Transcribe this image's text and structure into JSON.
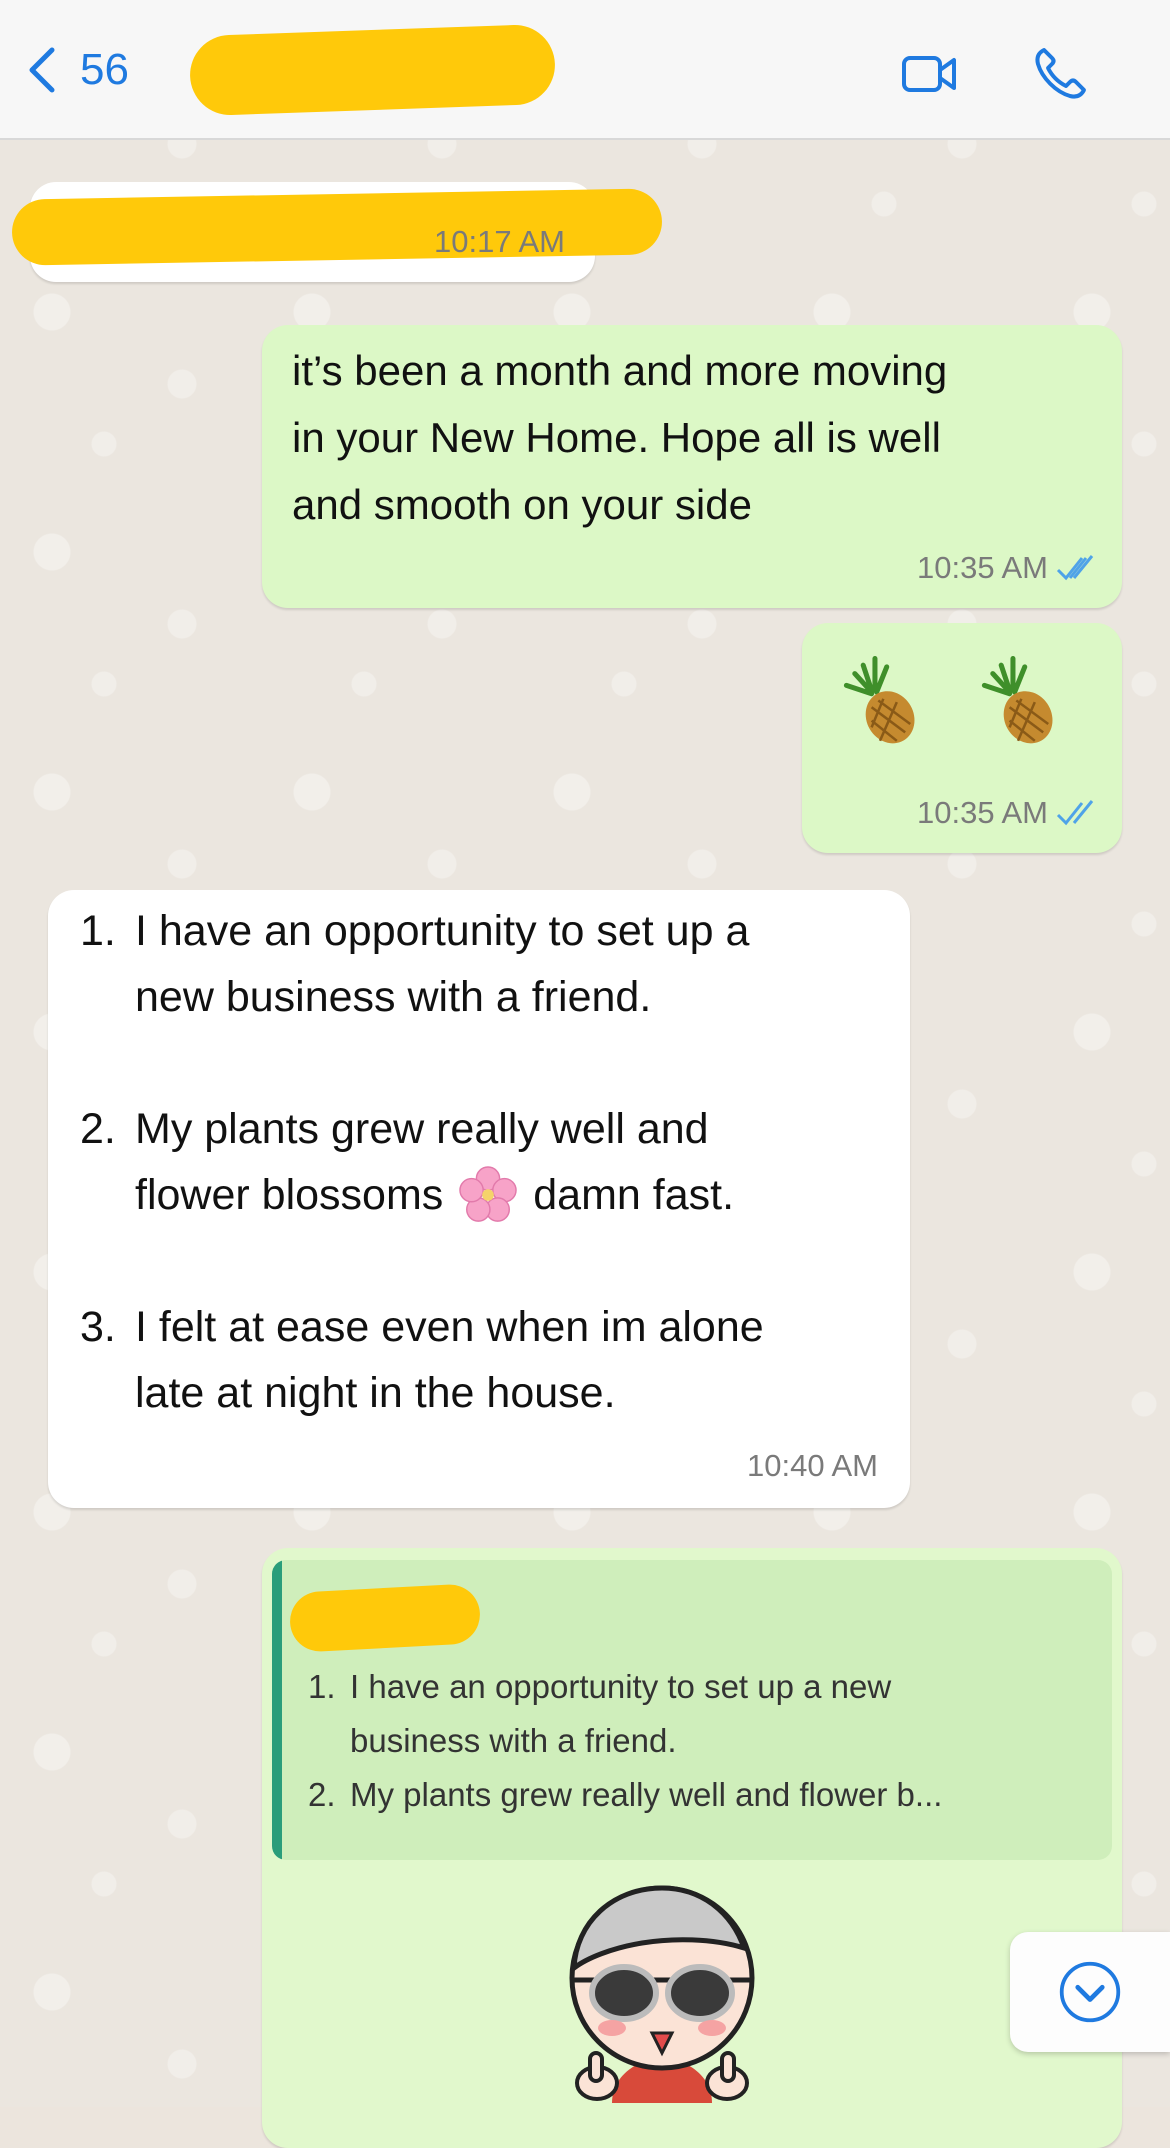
{
  "header": {
    "unread_count": "56",
    "video_icon": "video-camera-icon",
    "call_icon": "phone-icon"
  },
  "messages": [
    {
      "direction": "incoming",
      "time": "10:17 AM"
    },
    {
      "direction": "outgoing",
      "text_lines": [
        "it’s been a month and more moving",
        "in your New Home. Hope all is well",
        "and smooth on your side"
      ],
      "time": "10:35 AM",
      "status": "read"
    },
    {
      "direction": "outgoing",
      "emoji": "pineapple pineapple",
      "time": "10:35 AM",
      "status": "read"
    },
    {
      "direction": "incoming",
      "list": [
        {
          "num": "1.",
          "lines": [
            "I have an opportunity to set up a",
            "new business with a friend."
          ]
        },
        {
          "num": "2.",
          "lines": [
            "My plants grew really well and",
            "flower blossoms",
            "damn fast."
          ]
        },
        {
          "num": "3.",
          "lines": [
            "I felt at ease even when im alone",
            "late at night in the house."
          ]
        }
      ],
      "time": "10:40 AM"
    },
    {
      "direction": "outgoing",
      "quote": [
        {
          "num": "1.",
          "lines": [
            "I have an opportunity to set up a new",
            "business with a friend."
          ]
        },
        {
          "num": "2.",
          "lines": [
            "My plants grew really well and flower b..."
          ]
        }
      ],
      "sticker": "cartoon-boy-sunglasses-thumbs-up"
    }
  ],
  "colors": {
    "accent": "#1f7ae0",
    "outgoing_bubble": "#dcf8c6",
    "incoming_bubble": "#ffffff",
    "read_ticks": "#4fa3e8",
    "quote_bar": "#2a9d7a"
  }
}
